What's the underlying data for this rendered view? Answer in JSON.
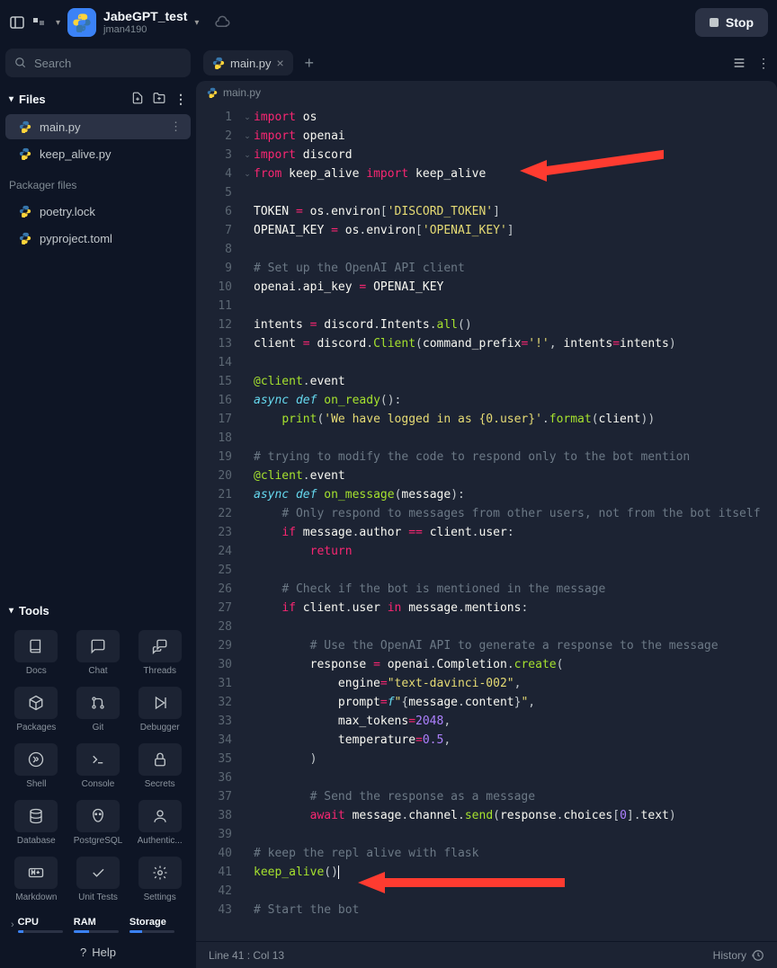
{
  "topbar": {
    "project_name": "JabeGPT_test",
    "project_owner": "jman4190",
    "stop_label": "Stop"
  },
  "sidebar": {
    "search_placeholder": "Search",
    "files_header": "Files",
    "files": [
      {
        "name": "main.py",
        "active": true
      },
      {
        "name": "keep_alive.py",
        "active": false
      }
    ],
    "packager_label": "Packager files",
    "packager_files": [
      {
        "name": "poetry.lock"
      },
      {
        "name": "pyproject.toml"
      }
    ],
    "tools_header": "Tools",
    "tools": [
      {
        "label": "Docs",
        "icon": "book"
      },
      {
        "label": "Chat",
        "icon": "chat"
      },
      {
        "label": "Threads",
        "icon": "threads"
      },
      {
        "label": "Packages",
        "icon": "cube"
      },
      {
        "label": "Git",
        "icon": "git"
      },
      {
        "label": "Debugger",
        "icon": "debug"
      },
      {
        "label": "Shell",
        "icon": "shell"
      },
      {
        "label": "Console",
        "icon": "console"
      },
      {
        "label": "Secrets",
        "icon": "lock"
      },
      {
        "label": "Database",
        "icon": "db"
      },
      {
        "label": "PostgreSQL",
        "icon": "postgres"
      },
      {
        "label": "Authentic...",
        "icon": "user"
      },
      {
        "label": "Markdown",
        "icon": "md"
      },
      {
        "label": "Unit Tests",
        "icon": "check"
      },
      {
        "label": "Settings",
        "icon": "gear"
      }
    ],
    "resources": [
      {
        "label": "CPU",
        "pct": 12
      },
      {
        "label": "RAM",
        "pct": 35
      },
      {
        "label": "Storage",
        "pct": 28
      }
    ],
    "help_label": "Help"
  },
  "tabs": {
    "open": [
      {
        "name": "main.py"
      }
    ],
    "breadcrumb_file": "main.py"
  },
  "editor": {
    "lines": [
      {
        "n": 1,
        "html": "<span class='kw2'>import</span> <span class='id'>os</span>"
      },
      {
        "n": 2,
        "html": "<span class='kw2'>import</span> <span class='id'>openai</span>"
      },
      {
        "n": 3,
        "html": "<span class='kw2'>import</span> <span class='id'>discord</span>"
      },
      {
        "n": 4,
        "html": "<span class='kw2'>from</span> <span class='id'>keep_alive</span> <span class='kw2'>import</span> <span class='id'>keep_alive</span>"
      },
      {
        "n": 5,
        "html": ""
      },
      {
        "n": 6,
        "html": "<span class='id'>TOKEN</span> <span class='op'>=</span> <span class='id'>os</span><span class='pl'>.</span><span class='id'>environ</span><span class='pl'>[</span><span class='str'>'DISCORD_TOKEN'</span><span class='pl'>]</span>"
      },
      {
        "n": 7,
        "html": "<span class='id'>OPENAI_KEY</span> <span class='op'>=</span> <span class='id'>os</span><span class='pl'>.</span><span class='id'>environ</span><span class='pl'>[</span><span class='str'>'OPENAI_KEY'</span><span class='pl'>]</span>"
      },
      {
        "n": 8,
        "html": ""
      },
      {
        "n": 9,
        "html": "<span class='com'># Set up the OpenAI API client</span>"
      },
      {
        "n": 10,
        "html": "<span class='id'>openai</span><span class='pl'>.</span><span class='id'>api_key</span> <span class='op'>=</span> <span class='id'>OPENAI_KEY</span>"
      },
      {
        "n": 11,
        "html": ""
      },
      {
        "n": 12,
        "html": "<span class='id'>intents</span> <span class='op'>=</span> <span class='id'>discord</span><span class='pl'>.</span><span class='id'>Intents</span><span class='pl'>.</span><span class='fn'>all</span><span class='pl'>()</span>"
      },
      {
        "n": 13,
        "html": "<span class='id'>client</span> <span class='op'>=</span> <span class='id'>discord</span><span class='pl'>.</span><span class='fn'>Client</span><span class='pl'>(</span><span class='id'>command_prefix</span><span class='op'>=</span><span class='str'>'!'</span><span class='pl'>, </span><span class='id'>intents</span><span class='op'>=</span><span class='id'>intents</span><span class='pl'>)</span>"
      },
      {
        "n": 14,
        "html": ""
      },
      {
        "n": 15,
        "html": "<span class='fn'>@client</span><span class='pl'>.</span><span class='id'>event</span>"
      },
      {
        "n": 16,
        "fold": true,
        "html": "<span class='kw'>async</span> <span class='kw'>def</span> <span class='fn'>on_ready</span><span class='pl'>():</span>"
      },
      {
        "n": 17,
        "html": "    <span class='fn'>print</span><span class='pl'>(</span><span class='str'>'We have logged in as {0.user}'</span><span class='pl'>.</span><span class='fn'>format</span><span class='pl'>(</span><span class='id'>client</span><span class='pl'>))</span>"
      },
      {
        "n": 18,
        "html": ""
      },
      {
        "n": 19,
        "html": "<span class='com'># trying to modify the code to respond only to the bot mention</span>"
      },
      {
        "n": 20,
        "html": "<span class='fn'>@client</span><span class='pl'>.</span><span class='id'>event</span>"
      },
      {
        "n": 21,
        "fold": true,
        "html": "<span class='kw'>async</span> <span class='kw'>def</span> <span class='fn'>on_message</span><span class='pl'>(</span><span class='id'>message</span><span class='pl'>):</span>"
      },
      {
        "n": 22,
        "html": "    <span class='com'># Only respond to messages from other users, not from the bot itself</span>"
      },
      {
        "n": 23,
        "fold": true,
        "html": "    <span class='kw2'>if</span> <span class='id'>message</span><span class='pl'>.</span><span class='id'>author</span> <span class='op'>==</span> <span class='id'>client</span><span class='pl'>.</span><span class='id'>user</span><span class='pl'>:</span>"
      },
      {
        "n": 24,
        "html": "        <span class='kw2'>return</span>"
      },
      {
        "n": 25,
        "html": ""
      },
      {
        "n": 26,
        "html": "    <span class='com'># Check if the bot is mentioned in the message</span>"
      },
      {
        "n": 27,
        "fold": true,
        "html": "    <span class='kw2'>if</span> <span class='id'>client</span><span class='pl'>.</span><span class='id'>user</span> <span class='kw2'>in</span> <span class='id'>message</span><span class='pl'>.</span><span class='id'>mentions</span><span class='pl'>:</span>"
      },
      {
        "n": 28,
        "html": ""
      },
      {
        "n": 29,
        "html": "        <span class='com'># Use the OpenAI API to generate a response to the message</span>"
      },
      {
        "n": 30,
        "html": "        <span class='id'>response</span> <span class='op'>=</span> <span class='id'>openai</span><span class='pl'>.</span><span class='id'>Completion</span><span class='pl'>.</span><span class='fn'>create</span><span class='pl'>(</span>"
      },
      {
        "n": 31,
        "html": "            <span class='id'>engine</span><span class='op'>=</span><span class='str'>\"text-davinci-002\"</span><span class='pl'>,</span>"
      },
      {
        "n": 32,
        "html": "            <span class='id'>prompt</span><span class='op'>=</span><span class='kw'>f</span><span class='str'>\"</span><span class='pl'>{</span><span class='id'>message</span><span class='pl'>.</span><span class='id'>content</span><span class='pl'>}</span><span class='str'>\"</span><span class='pl'>,</span>"
      },
      {
        "n": 33,
        "html": "            <span class='id'>max_tokens</span><span class='op'>=</span><span class='num'>2048</span><span class='pl'>,</span>"
      },
      {
        "n": 34,
        "html": "            <span class='id'>temperature</span><span class='op'>=</span><span class='num'>0.5</span><span class='pl'>,</span>"
      },
      {
        "n": 35,
        "html": "        <span class='pl'>)</span>"
      },
      {
        "n": 36,
        "html": ""
      },
      {
        "n": 37,
        "html": "        <span class='com'># Send the response as a message</span>"
      },
      {
        "n": 38,
        "html": "        <span class='kw2'>await</span> <span class='id'>message</span><span class='pl'>.</span><span class='id'>channel</span><span class='pl'>.</span><span class='fn'>send</span><span class='pl'>(</span><span class='id'>response</span><span class='pl'>.</span><span class='id'>choices</span><span class='pl'>[</span><span class='num'>0</span><span class='pl'>].</span><span class='id'>text</span><span class='pl'>)</span>"
      },
      {
        "n": 39,
        "html": ""
      },
      {
        "n": 40,
        "html": "<span class='com'># keep the repl alive with flask</span>"
      },
      {
        "n": 41,
        "cursor": true,
        "html": "<span class='fn'>keep_alive</span><span class='pl'>()</span>"
      },
      {
        "n": 42,
        "html": ""
      },
      {
        "n": 43,
        "html": "<span class='com'># Start the bot</span>"
      }
    ]
  },
  "status": {
    "position": "Line 41 : Col 13",
    "history_label": "History"
  }
}
